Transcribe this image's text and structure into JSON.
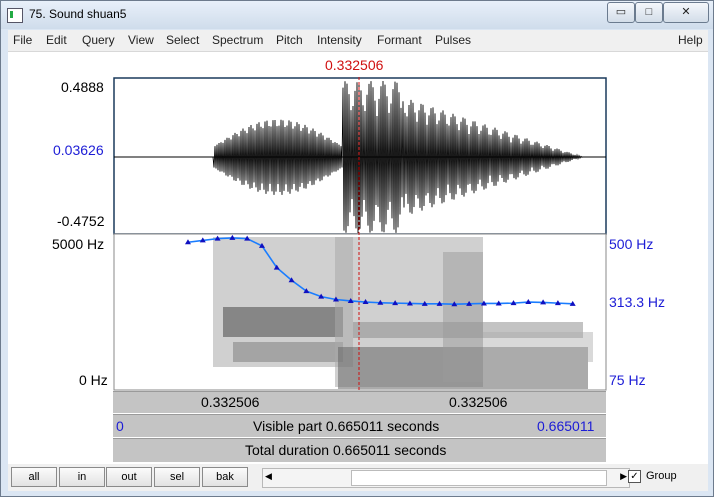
{
  "window": {
    "title": "75. Sound shuan5",
    "minimize_label": "▭",
    "maximize_label": "□",
    "close_label": "✕"
  },
  "menu": [
    "File",
    "Edit",
    "Query",
    "View",
    "Select",
    "Spectrum",
    "Pitch",
    "Intensity",
    "Formant",
    "Pulses",
    "Help"
  ],
  "cursor": {
    "time_label": "0.332506"
  },
  "waveform": {
    "y_max": "0.4888",
    "y_cursor": "0.03626",
    "y_min": "-0.4752"
  },
  "spectrogram": {
    "freq_top": "5000 Hz",
    "freq_bottom": "0 Hz",
    "pitch_top": "500 Hz",
    "pitch_current": "313.3 Hz",
    "pitch_bottom": "75 Hz"
  },
  "bars": {
    "left_segment": "0.332506",
    "right_segment": "0.332506",
    "visible_start": "0",
    "visible_part": "Visible part 0.665011 seconds",
    "visible_end": "0.665011",
    "total_duration": "Total duration 0.665011 seconds"
  },
  "toolbar": {
    "buttons": [
      "all",
      "in",
      "out",
      "sel",
      "bak"
    ],
    "group_label": "Group",
    "group_checked": true
  },
  "chart_data": {
    "type": "line",
    "title": "",
    "xlabel": "",
    "ylabel": "",
    "x_range": [
      0,
      0.665011
    ],
    "cursor_x": 0.332506,
    "pitch_ylim": [
      75,
      500
    ],
    "pitch_series": {
      "name": "",
      "x": [
        0.1,
        0.12,
        0.14,
        0.16,
        0.18,
        0.2,
        0.22,
        0.24,
        0.26,
        0.28,
        0.3,
        0.32,
        0.34,
        0.36,
        0.38,
        0.4,
        0.42,
        0.44,
        0.46,
        0.48,
        0.5,
        0.52,
        0.54,
        0.56,
        0.58,
        0.6,
        0.62
      ],
      "values": [
        480,
        485,
        490,
        492,
        490,
        470,
        410,
        375,
        345,
        330,
        322,
        318,
        315,
        313,
        312,
        311,
        310,
        310,
        309,
        310,
        311,
        311,
        312,
        315,
        314,
        312,
        310
      ]
    }
  }
}
